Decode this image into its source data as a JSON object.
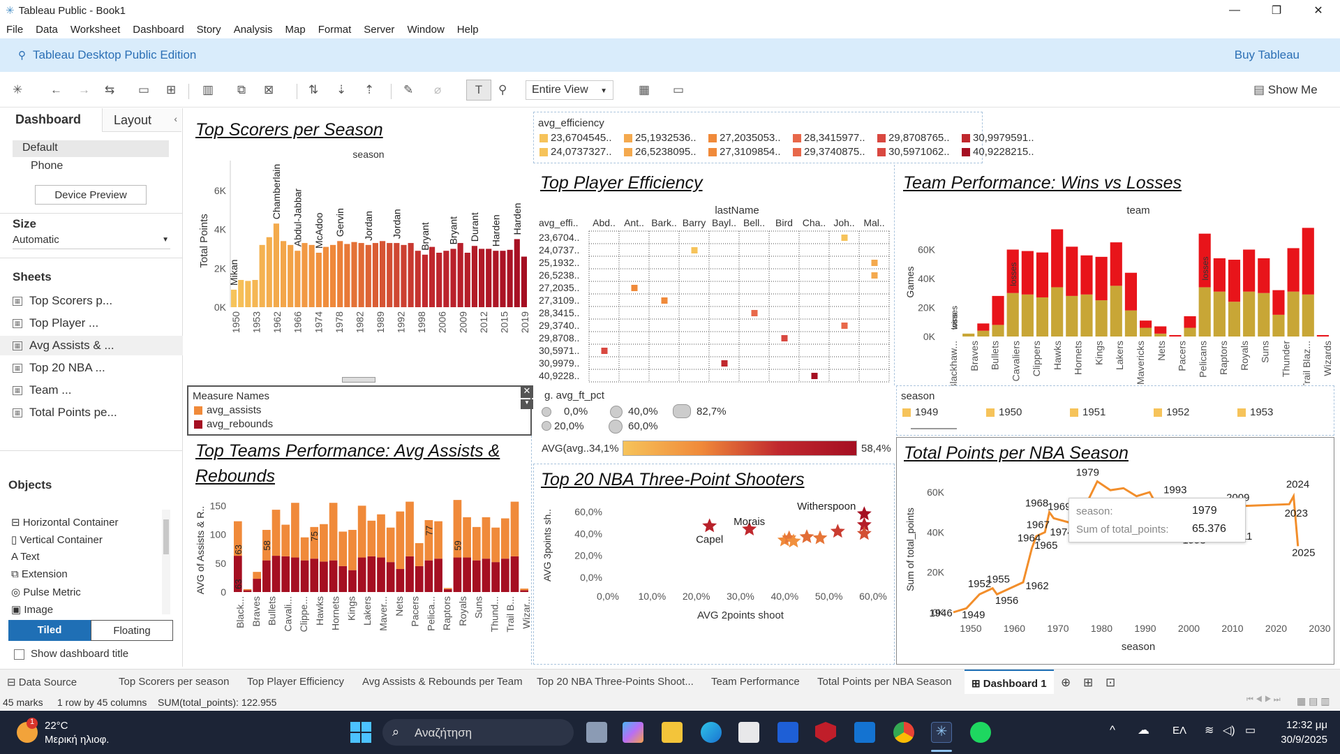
{
  "window": {
    "title": "Tableau Public - Book1"
  },
  "menu": [
    "File",
    "Data",
    "Worksheet",
    "Dashboard",
    "Story",
    "Analysis",
    "Map",
    "Format",
    "Server",
    "Window",
    "Help"
  ],
  "banner": {
    "edition": "Tableau Desktop Public Edition",
    "buy": "Buy Tableau"
  },
  "toolbar": {
    "view_mode": "Entire View",
    "show_me": "Show Me"
  },
  "left_panel": {
    "tab_dashboard": "Dashboard",
    "tab_layout": "Layout",
    "device_default": "Default",
    "device_phone": "Phone",
    "device_preview": "Device Preview",
    "size_label": "Size",
    "size_value": "Automatic",
    "sheets_label": "Sheets",
    "sheets": [
      "Top Scorers p...",
      "Top Player ...",
      "Avg Assists & ...",
      "Top 20 NBA ...",
      "Team ...",
      "Total Points pe..."
    ],
    "objects_label": "Objects",
    "objects": [
      "Horizontal Container",
      "Vertical Container",
      "Text",
      "Extension",
      "Pulse Metric",
      "Image"
    ],
    "tiled": "Tiled",
    "floating": "Floating",
    "show_title": "Show dashboard title"
  },
  "colors": {
    "orange_light": "#f6c35a",
    "orange": "#f08a3a",
    "red": "#c0282e",
    "dark_red": "#a50f22",
    "gold": "#c8a636",
    "bright_red": "#e8141a",
    "line_orange": "#f28e2b",
    "accent_blue": "#1f6fb5"
  },
  "top_scorers": {
    "title": "Top Scorers per Season",
    "chart_data": {
      "type": "bar",
      "title": "Top Scorers per Season",
      "header": "season",
      "ylabel": "Total Points",
      "ylim": [
        0,
        7000
      ],
      "yticks": [
        "0K",
        "2K",
        "4K",
        "6K"
      ],
      "xticks": [
        "1950",
        "1953",
        "1962",
        "1966",
        "1974",
        "1978",
        "1982",
        "1989",
        "1992",
        "1998",
        "2006",
        "2009",
        "2012",
        "2015",
        "2019"
      ],
      "values": [
        900,
        1400,
        1350,
        1400,
        3200,
        3600,
        4300,
        3400,
        3200,
        2900,
        3300,
        3200,
        2800,
        3100,
        3200,
        3400,
        3250,
        3350,
        3300,
        3200,
        3300,
        3400,
        3300,
        3300,
        3200,
        3300,
        2900,
        2700,
        3100,
        2800,
        2900,
        3000,
        3300,
        2800,
        3150,
        3000,
        3000,
        2900,
        2900,
        2950,
        3500,
        2600
      ],
      "labels": [
        {
          "i": 0,
          "t": "Mikan"
        },
        {
          "i": 6,
          "t": "Chamberlain"
        },
        {
          "i": 9,
          "t": "Abdul-Jabbar"
        },
        {
          "i": 12,
          "t": "McAdoo"
        },
        {
          "i": 15,
          "t": "Gervin"
        },
        {
          "i": 19,
          "t": "Jordan"
        },
        {
          "i": 23,
          "t": "Jordan"
        },
        {
          "i": 27,
          "t": "Bryant"
        },
        {
          "i": 31,
          "t": "Bryant"
        },
        {
          "i": 34,
          "t": "Durant"
        },
        {
          "i": 37,
          "t": "Harden"
        },
        {
          "i": 40,
          "t": "Harden"
        }
      ]
    }
  },
  "efficiency_legend": {
    "title": "avg_efficiency",
    "items": [
      "23,6704545..",
      "25,1932536..",
      "27,2035053..",
      "28,3415977..",
      "29,8708765..",
      "30,9979591..",
      "24,0737327..",
      "26,5238095..",
      "27,3109854..",
      "29,3740875..",
      "30,5971062..",
      "40,9228215.."
    ],
    "colors": [
      "#f6c35a",
      "#f4a94e",
      "#f08a3a",
      "#e8684a",
      "#d94840",
      "#c0282e",
      "#f6c35a",
      "#f4a94e",
      "#f08a3a",
      "#e8684a",
      "#d94840",
      "#a50f22"
    ]
  },
  "player_efficiency": {
    "title": "Top Player Efficiency",
    "chart_data": {
      "type": "table",
      "column_header": "lastName",
      "row_header": "avg_effi..",
      "columns": [
        "Abd..",
        "Ant..",
        "Bark..",
        "Barry",
        "Bayl..",
        "Bell..",
        "Bird",
        "Cha..",
        "Joh..",
        "Mal.."
      ],
      "rows": [
        "23,6704..",
        "24,0737..",
        "25,1932..",
        "26,5238..",
        "27,2035..",
        "27,3109..",
        "28,3415..",
        "29,3740..",
        "29,8708..",
        "30,5971..",
        "30,9979..",
        "40,9228.."
      ],
      "marks": [
        {
          "r": 0,
          "c": 8
        },
        {
          "r": 1,
          "c": 3
        },
        {
          "r": 2,
          "c": 9
        },
        {
          "r": 3,
          "c": 9
        },
        {
          "r": 4,
          "c": 1
        },
        {
          "r": 5,
          "c": 2
        },
        {
          "r": 6,
          "c": 5
        },
        {
          "r": 7,
          "c": 8
        },
        {
          "r": 8,
          "c": 6
        },
        {
          "r": 9,
          "c": 0
        },
        {
          "r": 10,
          "c": 4
        },
        {
          "r": 11,
          "c": 7
        }
      ]
    }
  },
  "team_performance": {
    "title": "Team Performance: Wins vs Losses",
    "chart_data": {
      "type": "bar",
      "header": "team",
      "ylabel": "Games",
      "yticks": [
        "0K",
        "20K",
        "40K",
        "60K"
      ],
      "ylim": [
        0,
        80000
      ],
      "series": [
        {
          "name": "wins",
          "values": [
            0,
            2000,
            4000,
            8000,
            30000,
            29000,
            27000,
            34000,
            28000,
            29000,
            25000,
            35000,
            18000,
            6000,
            2000,
            0,
            6000,
            34000,
            31000,
            24000,
            31000,
            30000,
            15000,
            31000,
            29000,
            0
          ]
        },
        {
          "name": "losses",
          "values": [
            0,
            0,
            5000,
            20000,
            30000,
            30000,
            31000,
            40000,
            34000,
            27000,
            30000,
            30000,
            26000,
            5000,
            5000,
            1000,
            8000,
            37000,
            23000,
            29000,
            29000,
            24000,
            17000,
            30000,
            46000,
            1000
          ]
        }
      ],
      "categories": [
        "Blackhaw...",
        "Braves",
        "Bullets",
        "Cavaliers",
        "Clippers",
        "Hawks",
        "Hornets",
        "Kings",
        "Lakers",
        "Mavericks",
        "Nets",
        "Pacers",
        "Pelicans",
        "Raptors",
        "Royals",
        "Suns",
        "Thunder",
        "Trail Blaz...",
        "Wizards"
      ],
      "inline_labels": [
        "wins",
        "losses",
        "losses",
        "losses"
      ]
    }
  },
  "measure_legend": {
    "title": "Measure Names",
    "items": [
      "avg_assists",
      "avg_rebounds"
    ]
  },
  "ft_legend": {
    "title": "g. avg_ft_pct",
    "items": [
      "0,0%",
      "40,0%",
      "82,7%",
      "20,0%",
      "60,0%"
    ]
  },
  "avg_color_legend": {
    "label": "AVG(avg..",
    "min": "34,1%",
    "max": "58,4%"
  },
  "season_legend": {
    "title": "season",
    "items": [
      "1949",
      "1950",
      "1951",
      "1952",
      "1953"
    ]
  },
  "assists_rebounds": {
    "title": "Top Teams Performance: Avg Assists & Rebounds",
    "chart_data": {
      "type": "bar",
      "header": "team",
      "ylabel": "AVG of Assists & R..",
      "yticks": [
        "0",
        "50",
        "100",
        "150"
      ],
      "ylim": [
        0,
        165
      ],
      "categories": [
        "Black...",
        "Braves",
        "Bullets",
        "Cavali...",
        "Clippe...",
        "Hawks",
        "Hornets",
        "Kings",
        "Lakers",
        "Maver...",
        "Nets",
        "Pacers",
        "Pelica...",
        "Raptors",
        "Royals",
        "Suns",
        "Thund...",
        "Trail B...",
        "Wizar..."
      ],
      "series": [
        {
          "name": "avg_rebounds",
          "values": [
            63,
            3,
            23,
            55,
            63,
            62,
            60,
            55,
            58,
            53,
            55,
            45,
            38,
            60,
            62,
            60,
            52,
            40,
            62,
            45,
            55,
            58,
            5,
            60,
            60,
            55,
            58,
            52,
            58,
            62,
            3
          ]
        },
        {
          "name": "avg_assists",
          "values": [
            60,
            2,
            12,
            53,
            80,
            55,
            95,
            40,
            55,
            65,
            100,
            60,
            70,
            90,
            62,
            75,
            60,
            100,
            95,
            40,
            70,
            65,
            2,
            100,
            70,
            58,
            72,
            60,
            70,
            95,
            3
          ]
        }
      ],
      "value_labels": [
        "63",
        "63",
        "58",
        "75",
        "77",
        "59"
      ]
    }
  },
  "three_point": {
    "title": "Top 20 NBA Three-Point Shooters",
    "chart_data": {
      "type": "scatter",
      "xlabel": "AVG 2points shoot",
      "ylabel": "AVG 3points sh..",
      "xticks": [
        "0,0%",
        "10,0%",
        "20,0%",
        "30,0%",
        "40,0%",
        "50,0%",
        "60,0%"
      ],
      "yticks": [
        "0,0%",
        "20,0%",
        "40,0%",
        "60,0%"
      ],
      "points": [
        {
          "x": 0.23,
          "y": 0.47,
          "label": "Capel"
        },
        {
          "x": 0.32,
          "y": 0.44,
          "label": "Morais"
        },
        {
          "x": 0.4,
          "y": 0.34
        },
        {
          "x": 0.41,
          "y": 0.36
        },
        {
          "x": 0.42,
          "y": 0.33
        },
        {
          "x": 0.45,
          "y": 0.37
        },
        {
          "x": 0.48,
          "y": 0.36
        },
        {
          "x": 0.52,
          "y": 0.42
        },
        {
          "x": 0.58,
          "y": 0.48
        },
        {
          "x": 0.58,
          "y": 0.4
        },
        {
          "x": 0.58,
          "y": 0.58,
          "label": "Witherspoon"
        }
      ]
    }
  },
  "total_points": {
    "title": "Total Points per NBA Season",
    "chart_data": {
      "type": "line",
      "xlabel": "season",
      "ylabel": "Sum of total_points",
      "xticks": [
        "1950",
        "1960",
        "1970",
        "1980",
        "1990",
        "2000",
        "2010",
        "2020",
        "2030"
      ],
      "yticks": [
        "0K",
        "20K",
        "40K",
        "60K"
      ],
      "x": [
        1946,
        1949,
        1952,
        1955,
        1956,
        1962,
        1964,
        1965,
        1967,
        1968,
        1969,
        1974,
        1975,
        1976,
        1979,
        1982,
        1985,
        1988,
        1991,
        1993,
        1998,
        2009,
        2011,
        2023,
        2024,
        2025
      ],
      "y": [
        0,
        2000,
        9000,
        12000,
        9000,
        15000,
        32000,
        38000,
        40000,
        50000,
        47000,
        44000,
        45000,
        52000,
        65400,
        61000,
        62000,
        58000,
        60000,
        52000,
        56000,
        55000,
        53000,
        54000,
        58000,
        33000
      ],
      "point_labels": [
        "1946",
        "1949",
        "1952",
        "1955",
        "1956",
        "1962",
        "1964",
        "1965",
        "1967",
        "1968",
        "1969",
        "1974",
        "1975",
        "1976",
        "1979",
        "1993",
        "1998",
        "2009",
        "2011",
        "2023",
        "2024",
        "2025"
      ],
      "tooltip": {
        "k1": "season:",
        "v1": "1979",
        "k2": "Sum of total_points:",
        "v2": "65.376"
      }
    }
  },
  "bottom_tabs": [
    "Data Source",
    "Top Scorers per season",
    "Top Player Efficiency",
    "Avg Assists & Rebounds per Team",
    "Top 20 NBA Three-Points Shoot...",
    "Team Performance",
    "Total Points per NBA Season",
    "Dashboard 1"
  ],
  "status": {
    "marks": "45 marks",
    "rows": "1 row by 45 columns",
    "sum": "SUM(total_points): 122.955"
  },
  "taskbar": {
    "temp": "22°C",
    "weather": "Μερική ηλιοφ.",
    "search": "Αναζήτηση",
    "lang": "ΕΛ",
    "time": "12:32 μμ",
    "date": "30/9/2025",
    "badge": "1"
  }
}
